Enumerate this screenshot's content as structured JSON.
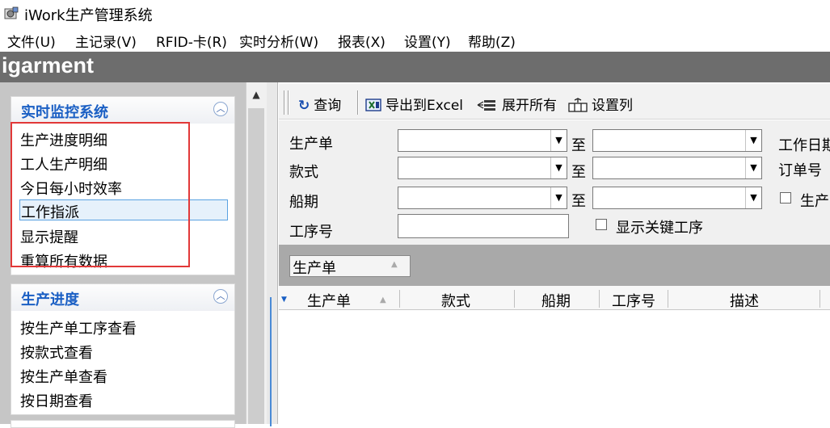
{
  "window": {
    "title": "iWork生产管理系统",
    "icon": "app-icon"
  },
  "menu": [
    "文件(U)",
    "主记录(V)",
    "RFID-卡(R)",
    "实时分析(W)",
    "报表(X)",
    "设置(Y)",
    "帮助(Z)"
  ],
  "banner": {
    "text": "igarment"
  },
  "sidebar": {
    "groups": [
      {
        "title": "实时监控系统",
        "items": [
          "生产进度明细",
          "工人生产明细",
          "今日每小时效率",
          "工作指派",
          "显示提醒",
          "重算所有数据"
        ],
        "selected": "工作指派"
      },
      {
        "title": "生产进度",
        "items": [
          "按生产单工序查看",
          "按款式查看",
          "按生产单查看",
          "按日期查看"
        ]
      }
    ]
  },
  "toolbar": {
    "query": "查询",
    "export": "导出到Excel",
    "expand": "展开所有",
    "columns": "设置列"
  },
  "filter": {
    "order_label": "生产单",
    "style_label": "款式",
    "ship_label": "船期",
    "op_label": "工序号",
    "to": "至",
    "workdate_label": "工作日期",
    "orderno_label": "订单号",
    "production_check_label": "生产",
    "show_key_ops": "显示关键工序"
  },
  "groupbar": {
    "chip": "生产单"
  },
  "grid": {
    "columns": [
      "生产单",
      "款式",
      "船期",
      "工序号",
      "描述"
    ]
  }
}
